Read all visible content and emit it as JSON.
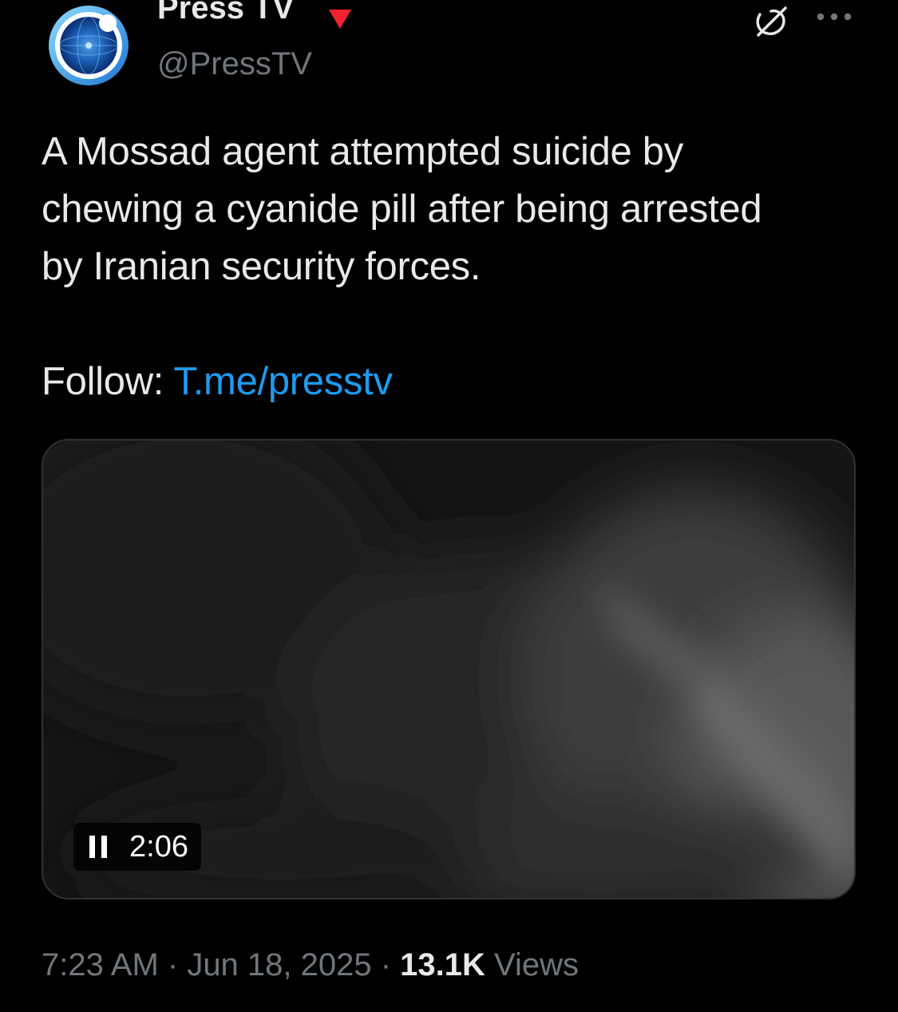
{
  "tweet": {
    "display_name": "Press TV",
    "handle": "@PressTV",
    "text": "A Mossad agent attempted suicide by\nchewing a cyanide pill after being arrested\nby Iranian security forces.",
    "follow_label": "Follow: ",
    "follow_link": "T.me/presstv",
    "video": {
      "duration": "2:06"
    },
    "time": "7:23 AM",
    "separator": " · ",
    "date": "Jun 18, 2025",
    "views_count": "13.1K",
    "views_label": " Views"
  },
  "icons": {
    "avatar": "presstv-logo",
    "badge": "red-triangle-badge",
    "grok": "grok-icon",
    "more": "more-dots-icon",
    "pause": "pause-icon"
  },
  "colors": {
    "background": "#000000",
    "text": "#e7e9ea",
    "secondary": "#71767b",
    "link": "#1d9bf0",
    "badge": "#f4212e"
  }
}
